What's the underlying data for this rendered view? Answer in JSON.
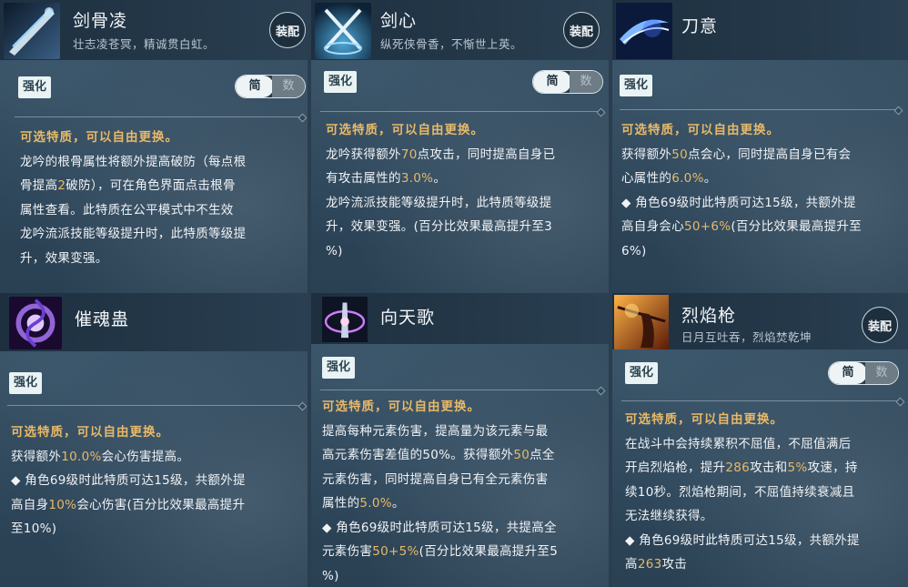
{
  "cards": [
    {
      "name": "剑骨凌",
      "subtitle": "壮志凌苍冥，精诚贯白虹。",
      "equip": "装配",
      "tag": "强化",
      "toggle": [
        "简",
        "数"
      ],
      "heading": "可选特质，可以自由更换。",
      "lines": [
        [
          "龙吟的根骨属性将额外提高破防（每点根"
        ],
        [
          "骨提高",
          {
            "num": "2"
          },
          "破防），可在角色界面点击根骨"
        ],
        [
          "属性查看。此特质在公平模式中不生效"
        ],
        [
          "龙吟流派技能等级提升时，此特质等级提"
        ],
        [
          "升，效果变强。"
        ]
      ]
    },
    {
      "name": "剑心",
      "subtitle": "纵死侠骨香，不惭世上英。",
      "equip": "装配",
      "tag": "强化",
      "toggle": [
        "简",
        "数"
      ],
      "heading": "可选特质，可以自由更换。",
      "lines": [
        [
          "龙吟获得额外",
          {
            "num": "70"
          },
          "点攻击，同时提高自身已"
        ],
        [
          "有攻击属性的",
          {
            "num": "3.0%"
          },
          "。"
        ],
        [
          "龙吟流派技能等级提升时，此特质等级提"
        ],
        [
          "升，效果变强。(百分比效果最高提升至3"
        ],
        [
          "%)"
        ]
      ]
    },
    {
      "name": "刀意",
      "tag": "强化",
      "heading": "可选特质，可以自由更换。",
      "lines": [
        [
          "获得额外",
          {
            "num": "50"
          },
          "点会心，同时提高自身已有会"
        ],
        [
          "心属性的",
          {
            "num": "6.0%"
          },
          "。"
        ],
        [
          "◆ 角色69级时此特质可达15级，共额外提"
        ],
        [
          "高自身会心",
          {
            "num": "50+6%"
          },
          "(百分比效果最高提升至"
        ],
        [
          "6%)"
        ]
      ]
    },
    {
      "name": "催魂蛊",
      "tag": "强化",
      "heading": "可选特质，可以自由更换。",
      "lines": [
        [
          "获得额外",
          {
            "num": "10.0%"
          },
          "会心伤害提高。"
        ],
        [
          "◆ 角色69级时此特质可达15级，共额外提"
        ],
        [
          "高自身",
          {
            "num": "10%"
          },
          "会心伤害(百分比效果最高提升"
        ],
        [
          "至10%)"
        ]
      ]
    },
    {
      "name": "向天歌",
      "tag": "强化",
      "heading": "可选特质，可以自由更换。",
      "lines": [
        [
          "提高每种元素伤害，提高量为该元素与最"
        ],
        [
          "高元素伤害差值的50%。获得额外",
          {
            "num": "50"
          },
          "点全"
        ],
        [
          "元素伤害，同时提高自身已有全元素伤害"
        ],
        [
          "属性的",
          {
            "num": "5.0%"
          },
          "。"
        ],
        [
          "◆ 角色69级时此特质可达15级，共提高全"
        ],
        [
          "元素伤害",
          {
            "num": "50+5%"
          },
          "(百分比效果最高提升至5"
        ],
        [
          "%)"
        ]
      ]
    },
    {
      "name": "烈焰枪",
      "subtitle": "日月互吐吞，烈焰焚乾坤",
      "equip": "装配",
      "tag": "强化",
      "toggle": [
        "简",
        "数"
      ],
      "heading": "可选特质，可以自由更换。",
      "lines": [
        [
          "在战斗中会持续累积不屈值，不屈值满后"
        ],
        [
          "开启烈焰枪，提升",
          {
            "num": "286"
          },
          "攻击和",
          {
            "num": "5%"
          },
          "攻速，持"
        ],
        [
          "续10秒。烈焰枪期间，不屈值持续衰减且"
        ],
        [
          "无法继续获得。"
        ],
        [
          "◆ 角色69级时此特质可达15级，共额外提"
        ],
        [
          "高",
          {
            "num": "263"
          },
          "攻击"
        ]
      ]
    }
  ],
  "icons": [
    "sword-bone-icon",
    "crossed-swords-icon",
    "blade-slash-icon",
    "soul-vortex-icon",
    "sky-song-icon",
    "flame-spear-icon"
  ],
  "colors": {
    "highlight": "#e8b968",
    "panel": "#2e4659",
    "tag_bg": "#e9f3f4"
  }
}
